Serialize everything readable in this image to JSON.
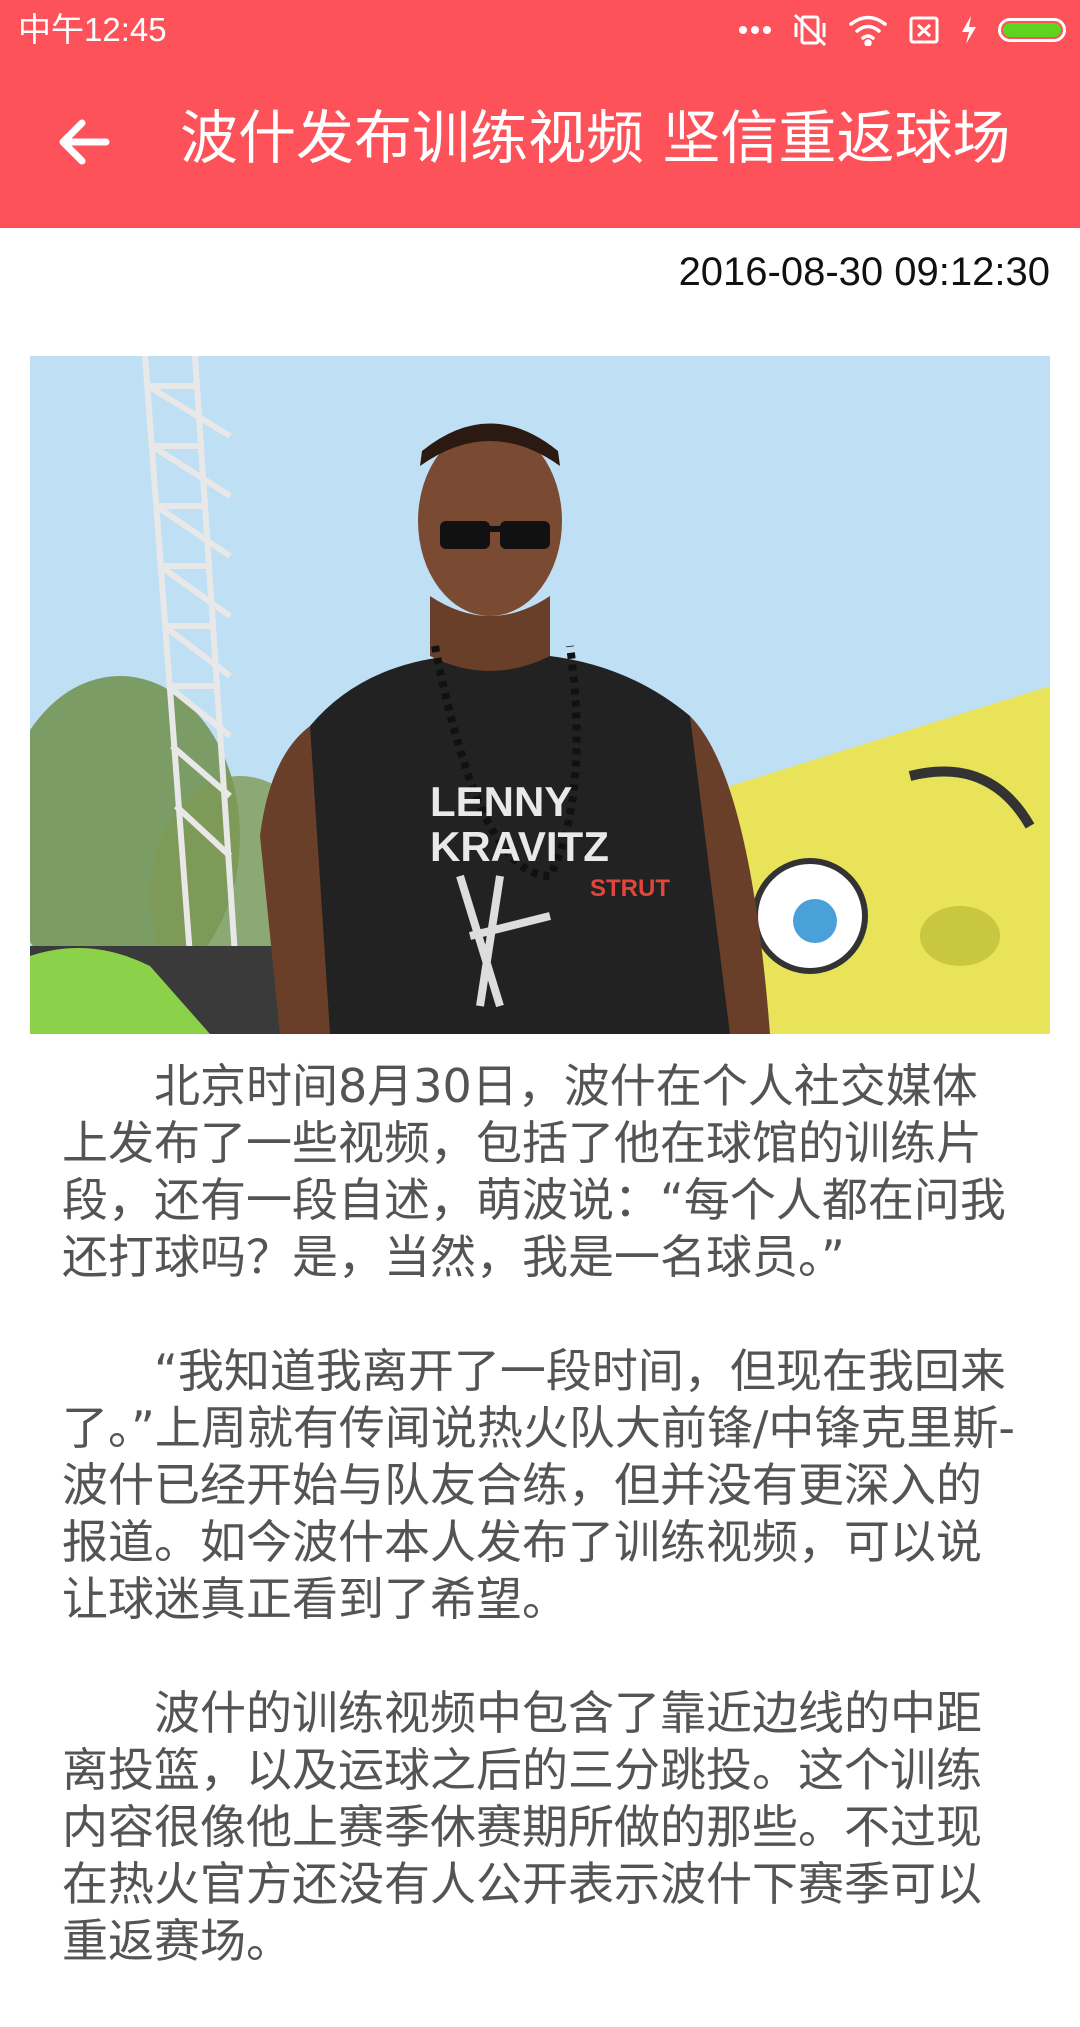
{
  "status_bar": {
    "time": "中午12:45",
    "icons": [
      "more-dots-icon",
      "vibrate-off-icon",
      "wifi-icon",
      "sim-off-icon",
      "charging-bolt-icon",
      "battery-icon"
    ],
    "battery_level": 1.0,
    "colors": {
      "background": "#fd5259",
      "battery": "#5ed41e"
    }
  },
  "toolbar": {
    "back_icon": "arrow-left-icon",
    "title": "波什发布训练视频 坚信重返球场"
  },
  "article": {
    "timestamp": "2016-08-30 09:12:30",
    "image_icon": "article-photo",
    "paragraphs": [
      "北京时间8月30日，波什在个人社交媒体上发布了一些视频，包括了他在球馆的训练片段，还有一段自述，萌波说：“每个人都在问我还打球吗？是，当然，我是一名球员。”",
      "“我知道我离开了一段时间，但现在我回来了。”上周就有传闻说热火队大前锋/中锋克里斯-波什已经开始与队友合练，但并没有更深入的报道。如今波什本人发布了训练视频，可以说让球迷真正看到了希望。",
      "波什的训练视频中包含了靠近边线的中距离投篮，以及运球之后的三分跳投。这个训练内容很像他上赛季休赛期所做的那些。不过现在热火官方还没有人公开表示波什下赛季可以重返赛场。"
    ]
  }
}
